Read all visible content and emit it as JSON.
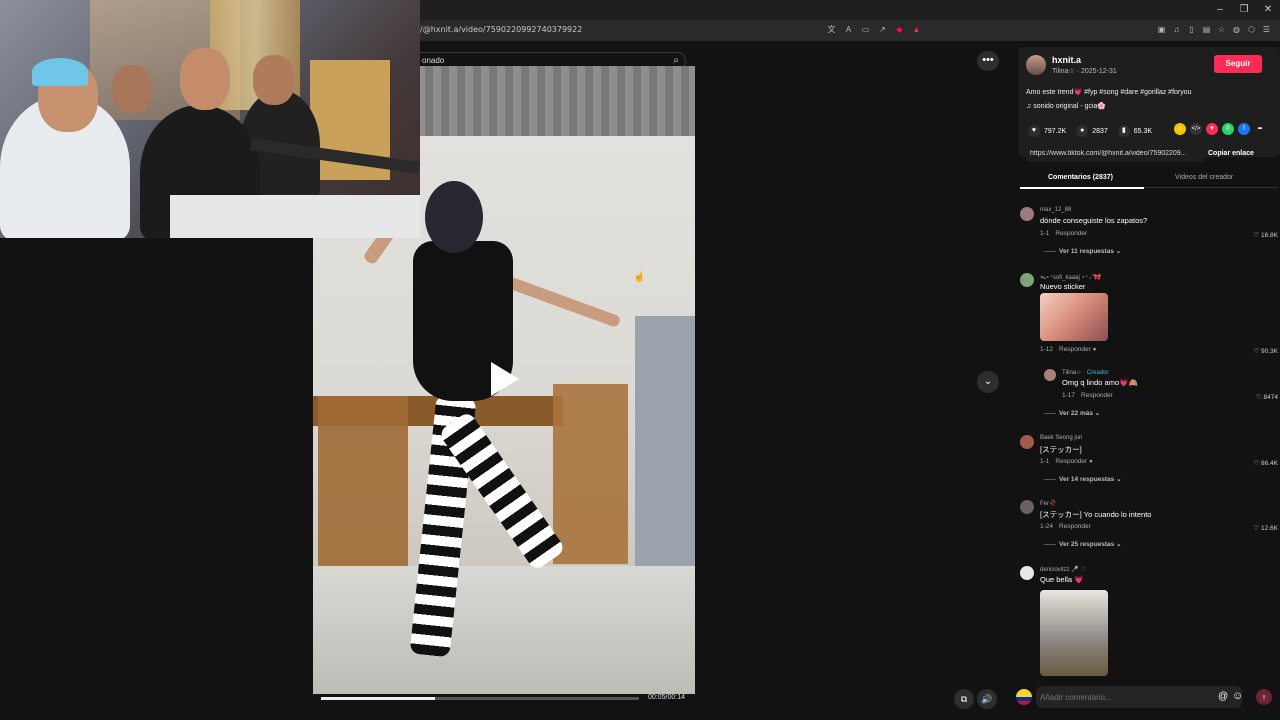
{
  "browser": {
    "url": "/@hxnit.a/video/7590220992740379922",
    "window_controls": [
      "–",
      "❐",
      "✕"
    ]
  },
  "search": {
    "text": "onado"
  },
  "video": {
    "time": "00:05/00:14",
    "progress": 0.36
  },
  "author": {
    "name": "hxnit.a",
    "subtitle": "Tilina☆ · 2025-12-31",
    "follow_label": "Seguir",
    "description": "Amo este trend💗 #fyp #song #dare #gorillaz #foryou",
    "sound": "♫  sonido original - gcia🌸"
  },
  "stats": {
    "likes": "797.2K",
    "comments": "2837",
    "saves": "65.3K"
  },
  "link": {
    "url": "https://www.tiktok.com/@hxnit.a/video/75902209...",
    "copy_label": "Copiar enlace"
  },
  "tabs": {
    "comments": "Comentarios (2837)",
    "creator_videos": "Videos del creador"
  },
  "comments": [
    {
      "user": "max_12_88",
      "text": "dónde conseguiste los zapatos?",
      "date": "1-1",
      "reply": "Responder",
      "likes": "16.8K",
      "more": "Ver 11 respuestas",
      "avatar": "#9c7a7f"
    },
    {
      "user": "ᯓ⋆⁺sofi_kaaaj ⋆⁺₊˚🎀",
      "text": "Nuevo sticker",
      "date": "1-12",
      "reply": "Responder",
      "likes": "90.3K",
      "avatar": "#7da27a"
    },
    {
      "user": "Tilina☆",
      "creator_label": "· Creador",
      "text": "Omg q lindo amo💗🙈",
      "date": "1-17",
      "reply": "Responder",
      "likes": "8474",
      "more": "Ver 22 más",
      "avatar": "#a88178"
    },
    {
      "user": "Baek Seong jun",
      "text": "[ステッカー]",
      "date": "1-1",
      "reply": "Responder",
      "likes": "86.4K",
      "more": "Ver 14 respuestas",
      "avatar": "#a45a4f"
    },
    {
      "user": "Fer🥀",
      "text": "[ステッカー] Yo cuando lo intento",
      "date": "1-24",
      "reply": "Responder",
      "likes": "12.6K",
      "more": "Ver 25 respuestas",
      "avatar": "#6b6068"
    },
    {
      "user": "denisovitzz 🎤 ♡",
      "text": "Que bella 💗",
      "avatar": "#e8e8e8"
    }
  ],
  "composer": {
    "placeholder": "Añadir comentario..."
  }
}
